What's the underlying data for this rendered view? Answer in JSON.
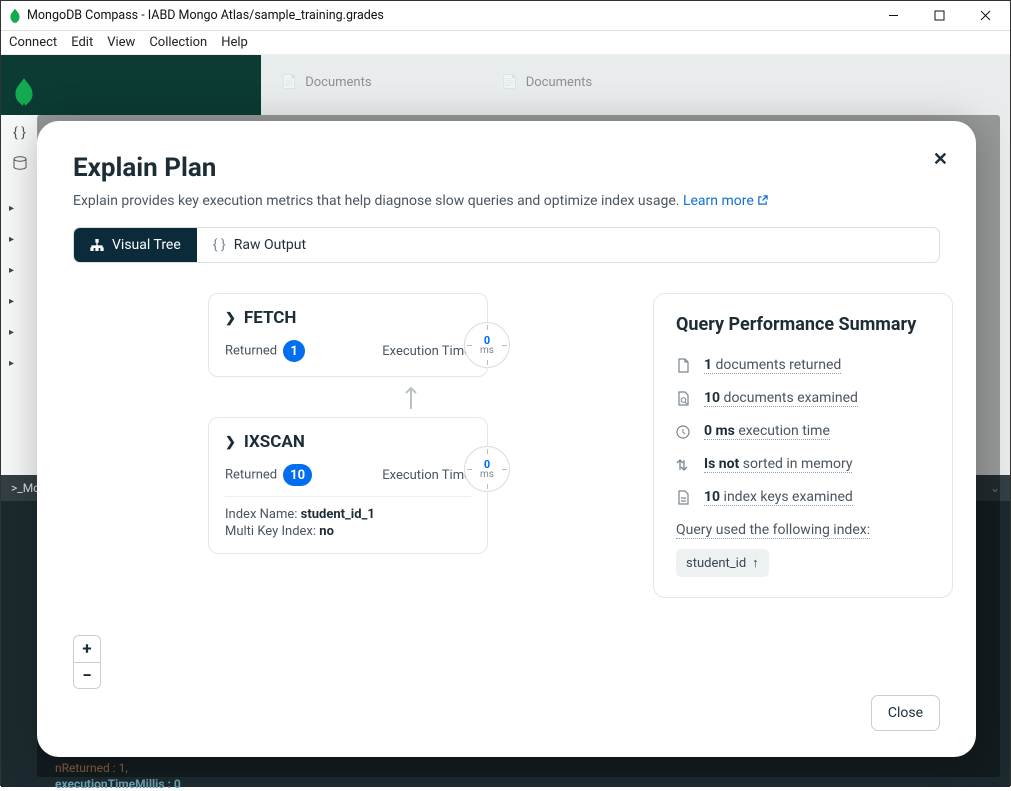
{
  "window": {
    "title": "MongoDB Compass - IABD Mongo Atlas/sample_training.grades"
  },
  "menu": {
    "connect": "Connect",
    "edit": "Edit",
    "view": "View",
    "collection": "Collection",
    "help": "Help"
  },
  "bgTabs": {
    "docs1": "Documents",
    "docs2": "Documents"
  },
  "console": {
    "prompt": ">_Mo",
    "line1": "nReturned : 1,",
    "line2": "executionTimeMillis : 0"
  },
  "modal": {
    "title": "Explain Plan",
    "subtitle": "Explain provides key execution metrics that help diagnose slow queries and optimize index usage.",
    "learnMore": "Learn more",
    "tabs": {
      "visual": "Visual Tree",
      "raw": "Raw Output"
    },
    "stages": {
      "fetch": {
        "name": "FETCH",
        "returnedLabel": "Returned",
        "returnedValue": "1",
        "execLabel": "Execution Time",
        "clockVal": "0",
        "clockUnit": "ms"
      },
      "ixscan": {
        "name": "IXSCAN",
        "returnedLabel": "Returned",
        "returnedValue": "10",
        "execLabel": "Execution Time",
        "clockVal": "0",
        "clockUnit": "ms",
        "indexNameLabel": "Index Name:",
        "indexNameValue": "student_id_1",
        "multiKeyLabel": "Multi Key Index:",
        "multiKeyValue": "no"
      }
    },
    "summary": {
      "heading": "Query Performance Summary",
      "items": {
        "docsReturned": {
          "bold": "1",
          "text": " documents returned"
        },
        "docsExamined": {
          "bold": "10",
          "text": " documents examined"
        },
        "execTime": {
          "bold": "0 ms",
          "text": " execution time"
        },
        "sorted": {
          "bold": "Is not",
          "text": " sorted in memory"
        },
        "keysExamined": {
          "bold": "10",
          "text": " index keys examined"
        }
      },
      "indexUsedLabel": "Query used the following index:",
      "indexName": "student_id"
    },
    "closeLabel": "Close"
  }
}
